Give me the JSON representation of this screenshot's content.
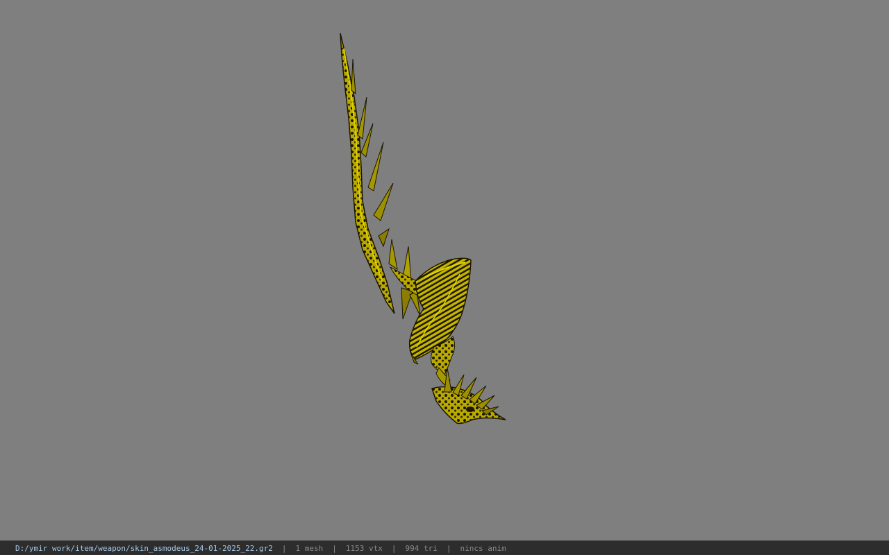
{
  "viewer": {
    "file_path": "D:/ymir work/item/weapon/skin_asmodeus_24-01-2025_22.gr2",
    "separator": "|",
    "mesh_count": "1 mesh",
    "vertex_count": "1153 vtx",
    "triangle_count": "994 tri",
    "animation_status": "nincs anim"
  },
  "colors": {
    "background": "#7f7f7f",
    "status_bar": "#2d2d2d",
    "path_text": "#a9c8e8",
    "stat_text": "#8a8a8a",
    "model_gold": "#c9b800",
    "model_dark": "#1e1a00"
  },
  "model": {
    "name": "skin_asmodeus weapon",
    "texture": "yellow-black organic"
  }
}
